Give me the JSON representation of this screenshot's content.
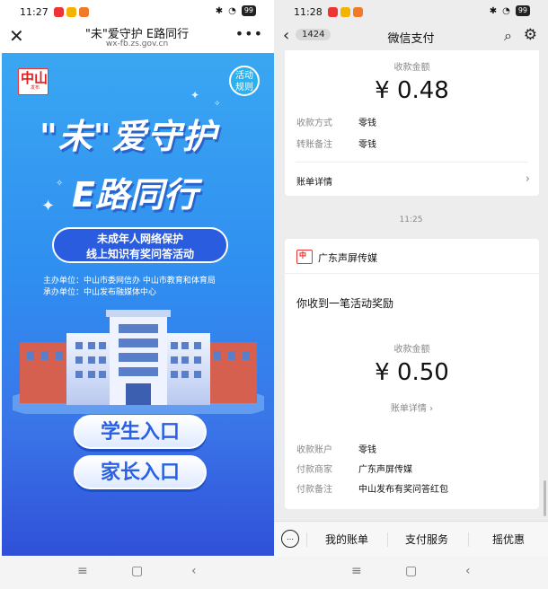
{
  "left": {
    "status": {
      "time": "11:27",
      "battery": "99"
    },
    "nav": {
      "close": "✕",
      "title": "\"未\"爱守护 E路同行",
      "url": "wx-fb.zs.gov.cn",
      "more": "•••"
    },
    "poster": {
      "logo_main": "中山",
      "logo_sub": "发布",
      "rules_label": "活动\n规则",
      "headline_1": "\"未\"爱守护",
      "headline_2": "E路同行",
      "subtitle_line1": "未成年人网络保护",
      "subtitle_line2": "线上知识有奖问答活动",
      "organizer_1": "主办单位：中山市委网信办 中山市教育和体育局",
      "organizer_2": "承办单位：中山发布融媒体中心",
      "student_button": "学生入口",
      "parent_button": "家长入口"
    },
    "navbar": {
      "menu": "≡",
      "home": "▢",
      "back": "‹"
    }
  },
  "right": {
    "status": {
      "time": "11:28",
      "battery": "99"
    },
    "nav": {
      "back": "‹",
      "badge": "1424",
      "title": "微信支付",
      "search": "⌕",
      "settings": "⚙"
    },
    "card1": {
      "amount_label": "收款金额",
      "amount": "¥ 0.48",
      "rows": [
        {
          "label": "收款方式",
          "value": "零钱"
        },
        {
          "label": "转账备注",
          "value": "零钱"
        }
      ],
      "detail_link": "账单详情",
      "chevron": "›"
    },
    "timestamp": "11:25",
    "card2": {
      "merchant": "广东声屏传媒",
      "message": "你收到一笔活动奖励",
      "amount_label": "收款金额",
      "amount": "¥ 0.50",
      "detail_link": "账单详情 ›",
      "rows": [
        {
          "label": "收款账户",
          "value": "零钱"
        },
        {
          "label": "付款商家",
          "value": "广东声屏传媒"
        },
        {
          "label": "付款备注",
          "value": "中山发布有奖问答红包"
        }
      ]
    },
    "bottom_tabs": [
      "我的账单",
      "支付服务",
      "摇优惠"
    ],
    "navbar": {
      "menu": "≡",
      "home": "▢",
      "back": "‹"
    }
  }
}
